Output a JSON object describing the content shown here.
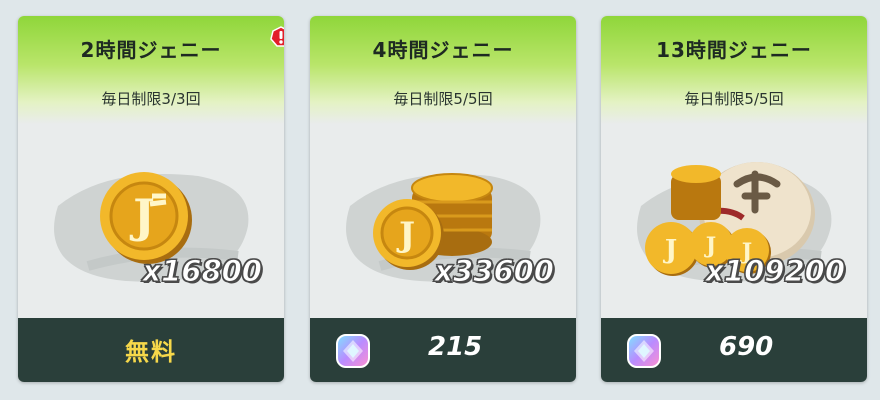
{
  "cards": [
    {
      "title": "2時間ジェニー",
      "limit": "毎日制限3/3回",
      "amount": "x16800",
      "price": "無料",
      "price_type": "free",
      "has_alert": true
    },
    {
      "title": "4時間ジェニー",
      "limit": "毎日制限5/5回",
      "amount": "x33600",
      "price": "215",
      "price_type": "gem",
      "has_alert": false
    },
    {
      "title": "13時間ジェニー",
      "limit": "毎日制限5/5回",
      "amount": "x109200",
      "price": "690",
      "price_type": "gem",
      "has_alert": false
    }
  ],
  "icons": {
    "alert": "exclamation-badge-icon",
    "currency": "gem-icon",
    "item": [
      "single-coin-icon",
      "coin-stack-icon",
      "coin-bag-icon"
    ]
  },
  "colors": {
    "header_green": "#8fd63a",
    "footer": "#2a3f3a",
    "free_text": "#f6d84a",
    "coin": "#f2b82a",
    "alert": "#e21f2a"
  }
}
